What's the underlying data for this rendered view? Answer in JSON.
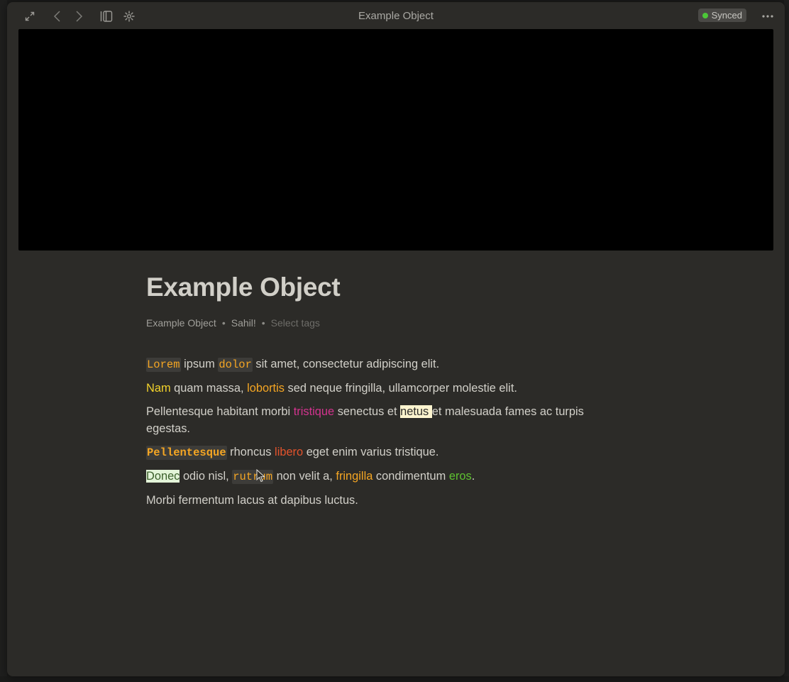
{
  "window": {
    "title": "Example Object",
    "sync_status": "Synced",
    "sync_color": "#4cc738"
  },
  "toolbar": {
    "icons": [
      "expand-icon",
      "back-arrow-icon",
      "forward-arrow-icon",
      "sidebar-toggle-icon",
      "graph-icon",
      "more-icon"
    ]
  },
  "cover": {
    "color": "#000000"
  },
  "document": {
    "title": "Example Object",
    "type": "Example Object",
    "author": "Sahil!",
    "tags_placeholder": "Select tags",
    "separator": "•",
    "paragraphs": {
      "p1": {
        "s1": "Lorem",
        "s2": " ipsum ",
        "s3": "dolor",
        "s4": " sit amet, consectetur adipiscing elit."
      },
      "p2": {
        "s1": "Nam",
        "s2": " quam massa, ",
        "s3": "lobortis",
        "s4": " sed neque fringilla, ullamcorper molestie elit."
      },
      "p3": {
        "s1": "Pellentesque habitant morbi ",
        "s2": "tristique",
        "s3": " senectus et ",
        "s4": "netus ",
        "s5": "et malesuada fames ac turpis egestas."
      },
      "p4": {
        "s1": "Pellentesque",
        "s2": " rhoncus ",
        "s3": "libero",
        "s4": " eget enim varius tristique."
      },
      "p5": {
        "s1": "Donec",
        "s2": " odio nisl, ",
        "s3": "rutrum",
        "s4": " non velit a, ",
        "s5": "fringilla",
        "s6": " condimentum ",
        "s7": "eros",
        "s8": "."
      },
      "p6": {
        "s1": "Morbi fermentum lacus at dapibus luctus."
      }
    }
  },
  "colors": {
    "background": "#2c2b28",
    "text": "#d2d0c9",
    "orange": "#f5a623",
    "yellow": "#f2d22b",
    "pink": "#d3338f",
    "red": "#e3532c",
    "green": "#5ec130"
  }
}
